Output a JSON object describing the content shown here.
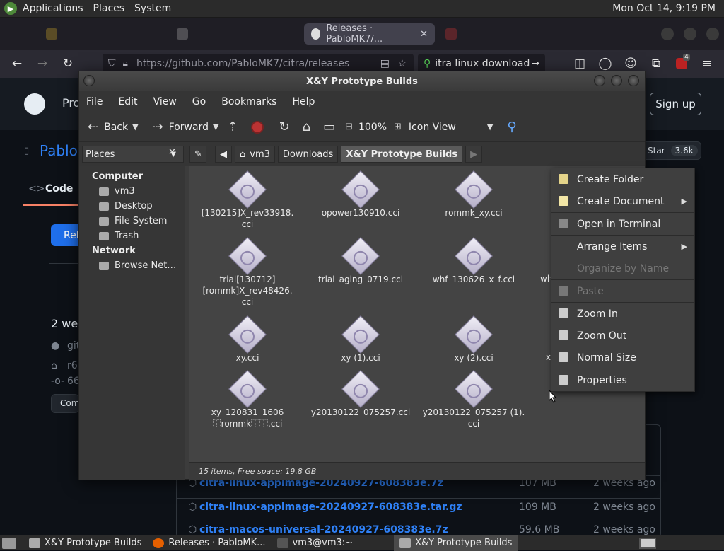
{
  "top_panel": {
    "menus": [
      "Applications",
      "Places",
      "System"
    ],
    "clock": "Mon Oct 14,  9:19 PM"
  },
  "browser": {
    "tabs": [
      {
        "label": "Releases · PabloMK7/...",
        "active": true
      }
    ],
    "url_prefix": "https://github.com/",
    "url_rest": "PabloMK7/citra/releases",
    "search_text": "itra linux download",
    "addon_badge": "4"
  },
  "github": {
    "nav_partial": "Pro",
    "sign_up": "Sign up",
    "repo_partial": "Pablo",
    "star_label": "Star",
    "star_count": "3.6k",
    "code_tab": "Code",
    "release_btn_partial": "Rel",
    "weeks_partial": "2 wee",
    "line1_partial": "git",
    "line2_partial": "r6",
    "line3_partial": "66",
    "comp_partial": "Com",
    "assets": [
      {
        "name": "citra-linux-appimage-20240927-608383e.7z",
        "size": "107 MB",
        "date": "2 weeks ago"
      },
      {
        "name": "citra-linux-appimage-20240927-608383e.tar.gz",
        "size": "109 MB",
        "date": "2 weeks ago"
      },
      {
        "name": "citra-macos-universal-20240927-608383e.7z",
        "size": "59.6 MB",
        "date": "2 weeks ago"
      }
    ]
  },
  "caja": {
    "title": "X&Y Prototype Builds",
    "menu": [
      "File",
      "Edit",
      "View",
      "Go",
      "Bookmarks",
      "Help"
    ],
    "toolbar": {
      "back": "Back",
      "forward": "Forward",
      "zoom": "100%",
      "view": "Icon View"
    },
    "places_label": "Places",
    "breadcrumbs": [
      "vm3",
      "Downloads",
      "X&Y Prototype Builds"
    ],
    "sidebar": {
      "computer": "Computer",
      "computer_items": [
        "vm3",
        "Desktop",
        "File System",
        "Trash"
      ],
      "network": "Network",
      "network_items": [
        "Browse Net…"
      ]
    },
    "files": [
      "[130215]X_rev33918.\ncci",
      "opower130910.cci",
      "rommk_xy.cci",
      "trial[130712]\n[rommk]X_rev48426.\ncci",
      "trial_aging_0719.cci",
      "whf_130626_x_f.cci",
      "xy.cci",
      "xy (1).cci",
      "xy (2).cci",
      "xy_120831_1606\n⿰rommk⿰⿰.cci",
      "y20130122_075257.cci",
      "y20130122_075257 (1).\ncci"
    ],
    "partial_files": [
      "wh",
      "x"
    ],
    "status": "15 items, Free space: 19.8 GB"
  },
  "context_menu": {
    "items": [
      {
        "label": "Create Folder",
        "disabled": false,
        "submenu": false
      },
      {
        "label": "Create Document",
        "disabled": false,
        "submenu": true
      },
      {
        "label": "Open in Terminal",
        "disabled": false,
        "submenu": false
      },
      {
        "label": "Arrange Items",
        "disabled": false,
        "submenu": true
      },
      {
        "label": "Organize by Name",
        "disabled": true,
        "submenu": false
      },
      {
        "label": "Paste",
        "disabled": true,
        "submenu": false
      },
      {
        "label": "Zoom In",
        "disabled": false,
        "submenu": false
      },
      {
        "label": "Zoom Out",
        "disabled": false,
        "submenu": false
      },
      {
        "label": "Normal Size",
        "disabled": false,
        "submenu": false
      },
      {
        "label": "Properties",
        "disabled": false,
        "submenu": false
      }
    ]
  },
  "taskbar": {
    "items": [
      {
        "label": "X&Y Prototype Builds",
        "active": false
      },
      {
        "label": "Releases · PabloMK...",
        "active": false
      },
      {
        "label": "vm3@vm3:~",
        "active": false
      },
      {
        "label": "X&Y Prototype Builds",
        "active": true
      }
    ]
  }
}
